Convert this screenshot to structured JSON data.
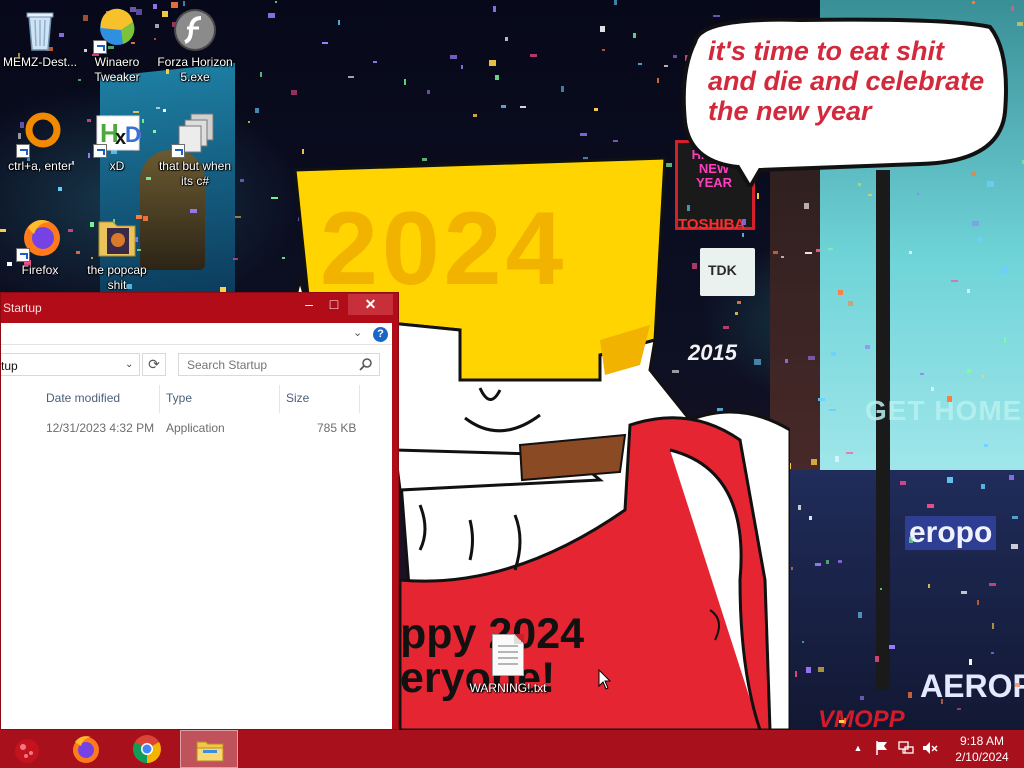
{
  "desktop": {
    "icons": [
      {
        "label": "MEMZ-Dest...",
        "icon": "recycle-bin-icon"
      },
      {
        "label": "Winaero Tweaker",
        "icon": "winaero-tweaker-icon"
      },
      {
        "label": "Forza Horizon 5.exe",
        "icon": "flash-icon"
      },
      {
        "label": "ctrl+a, enter",
        "icon": "orange-ring-icon"
      },
      {
        "label": "xD",
        "icon": "hxd-icon"
      },
      {
        "label": "that but when its c#",
        "icon": "stacked-windows-icon"
      },
      {
        "label": "Firefox",
        "icon": "firefox-icon"
      },
      {
        "label": "the popcap shit",
        "icon": "folder-icon"
      }
    ],
    "file": {
      "label": "WARNING!.txt",
      "icon": "text-file-icon"
    }
  },
  "wallpaper": {
    "hat_text": "2024",
    "shirt_lines": [
      "ppy 2024",
      "eryone!"
    ],
    "speech_lines": [
      "it's time to eat shit",
      "and die and celebrate",
      "the new year"
    ],
    "billboards": {
      "happy_new_year": "HAPPY NEW YEAR",
      "toshiba": "TOSHIBA",
      "tdk": "TDK",
      "year": "2015",
      "get_home": "GET HOME",
      "aerop": "eropo",
      "aerofos": "AEROFOS",
      "vmoorn": "VMOPP"
    }
  },
  "explorer": {
    "title": "Startup",
    "address": "tup",
    "search_placeholder": "Search Startup",
    "columns": [
      "Date modified",
      "Type",
      "Size"
    ],
    "rows": [
      {
        "date": "12/31/2023 4:32 PM",
        "type": "Application",
        "size": "785 KB"
      }
    ],
    "buttons": {
      "minimize": "–",
      "maximize": "□",
      "close": "✕",
      "refresh": "⟳",
      "dropdown": "⌄",
      "help": "?"
    }
  },
  "taskbar": {
    "apps": [
      {
        "name": "start",
        "icon": "start-orb-icon"
      },
      {
        "name": "firefox",
        "icon": "firefox-icon"
      },
      {
        "name": "chrome",
        "icon": "chrome-icon"
      },
      {
        "name": "file-explorer",
        "icon": "folder-icon"
      }
    ],
    "tray": {
      "show_hidden": "▲",
      "time": "9:18 AM",
      "date": "2/10/2024"
    }
  },
  "colors": {
    "taskbar": "#a8101c",
    "window_frame": "#b20c18",
    "close_button": "#c7303a",
    "hat_yellow": "#ffd400",
    "shirt_red": "#e52632",
    "speech_red": "#d22a3c",
    "help_blue": "#1a66c8"
  }
}
